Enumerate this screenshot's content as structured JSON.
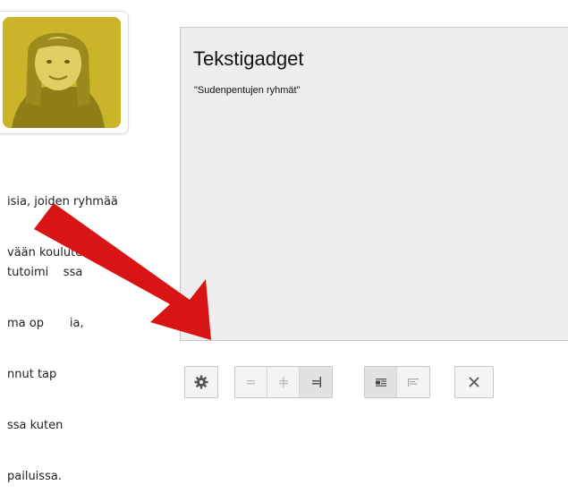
{
  "left_text": {
    "para1": [
      "isia, joiden ryhmää",
      "vään koulutettu"
    ],
    "para2": [
      "tutoimi    ssa",
      "ma op       ia,",
      "nnut tap",
      "ssa kuten",
      "pailuissa."
    ]
  },
  "gadget": {
    "title": "Tekstigadget",
    "text": "\"Sudenpentujen ryhmät\""
  },
  "toolbar": {
    "buttons": [
      {
        "icon": "gear-icon",
        "state": "normal"
      },
      {
        "icon": "align-left-icon",
        "state": "disabled"
      },
      {
        "icon": "align-center-icon",
        "state": "disabled"
      },
      {
        "icon": "align-right-icon",
        "state": "active"
      },
      {
        "icon": "text-wrap-icon",
        "state": "active"
      },
      {
        "icon": "no-wrap-icon",
        "state": "normal"
      },
      {
        "icon": "close-icon",
        "state": "normal"
      }
    ]
  },
  "colors": {
    "arrow": "#d81414",
    "gadget_bg": "#eeeeee",
    "photo_tint": "#cdb82c"
  }
}
